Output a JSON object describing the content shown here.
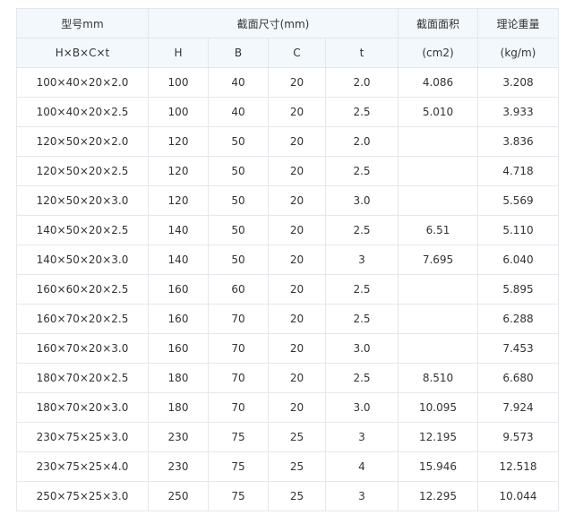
{
  "table": {
    "header_row1": {
      "model": "型号mm",
      "section_dims": "截面尺寸(mm)",
      "area": "截面面积",
      "weight": "理论重量"
    },
    "header_row2": {
      "model_sub": "H×B×C×t",
      "h": "H",
      "b": "B",
      "c": "C",
      "t": "t",
      "area_unit": "(cm2)",
      "weight_unit": "(kg/m)"
    },
    "rows": [
      [
        "100×40×20×2.0",
        "100",
        "40",
        "20",
        "2.0",
        "4.086",
        "3.208"
      ],
      [
        "100×40×20×2.5",
        "100",
        "40",
        "20",
        "2.5",
        "5.010",
        "3.933"
      ],
      [
        "120×50×20×2.0",
        "120",
        "50",
        "20",
        "2.0",
        "",
        "3.836"
      ],
      [
        "120×50×20×2.5",
        "120",
        "50",
        "20",
        "2.5",
        "",
        "4.718"
      ],
      [
        "120×50×20×3.0",
        "120",
        "50",
        "20",
        "3.0",
        "",
        "5.569"
      ],
      [
        "140×50×20×2.5",
        "140",
        "50",
        "20",
        "2.5",
        "6.51",
        "5.110"
      ],
      [
        "140×50×20×3.0",
        "140",
        "50",
        "20",
        "3",
        "7.695",
        "6.040"
      ],
      [
        "160×60×20×2.5",
        "160",
        "60",
        "20",
        "2.5",
        "",
        "5.895"
      ],
      [
        "160×70×20×2.5",
        "160",
        "70",
        "20",
        "2.5",
        "",
        "6.288"
      ],
      [
        "160×70×20×3.0",
        "160",
        "70",
        "20",
        "3.0",
        "",
        "7.453"
      ],
      [
        "180×70×20×2.5",
        "180",
        "70",
        "20",
        "2.5",
        "8.510",
        "6.680"
      ],
      [
        "180×70×20×3.0",
        "180",
        "70",
        "20",
        "3.0",
        "10.095",
        "7.924"
      ],
      [
        "230×75×25×3.0",
        "230",
        "75",
        "25",
        "3",
        "12.195",
        "9.573"
      ],
      [
        "230×75×25×4.0",
        "230",
        "75",
        "25",
        "4",
        "15.946",
        "12.518"
      ],
      [
        "250×75×25×3.0",
        "250",
        "75",
        "25",
        "3",
        "12.295",
        "10.044"
      ]
    ]
  }
}
